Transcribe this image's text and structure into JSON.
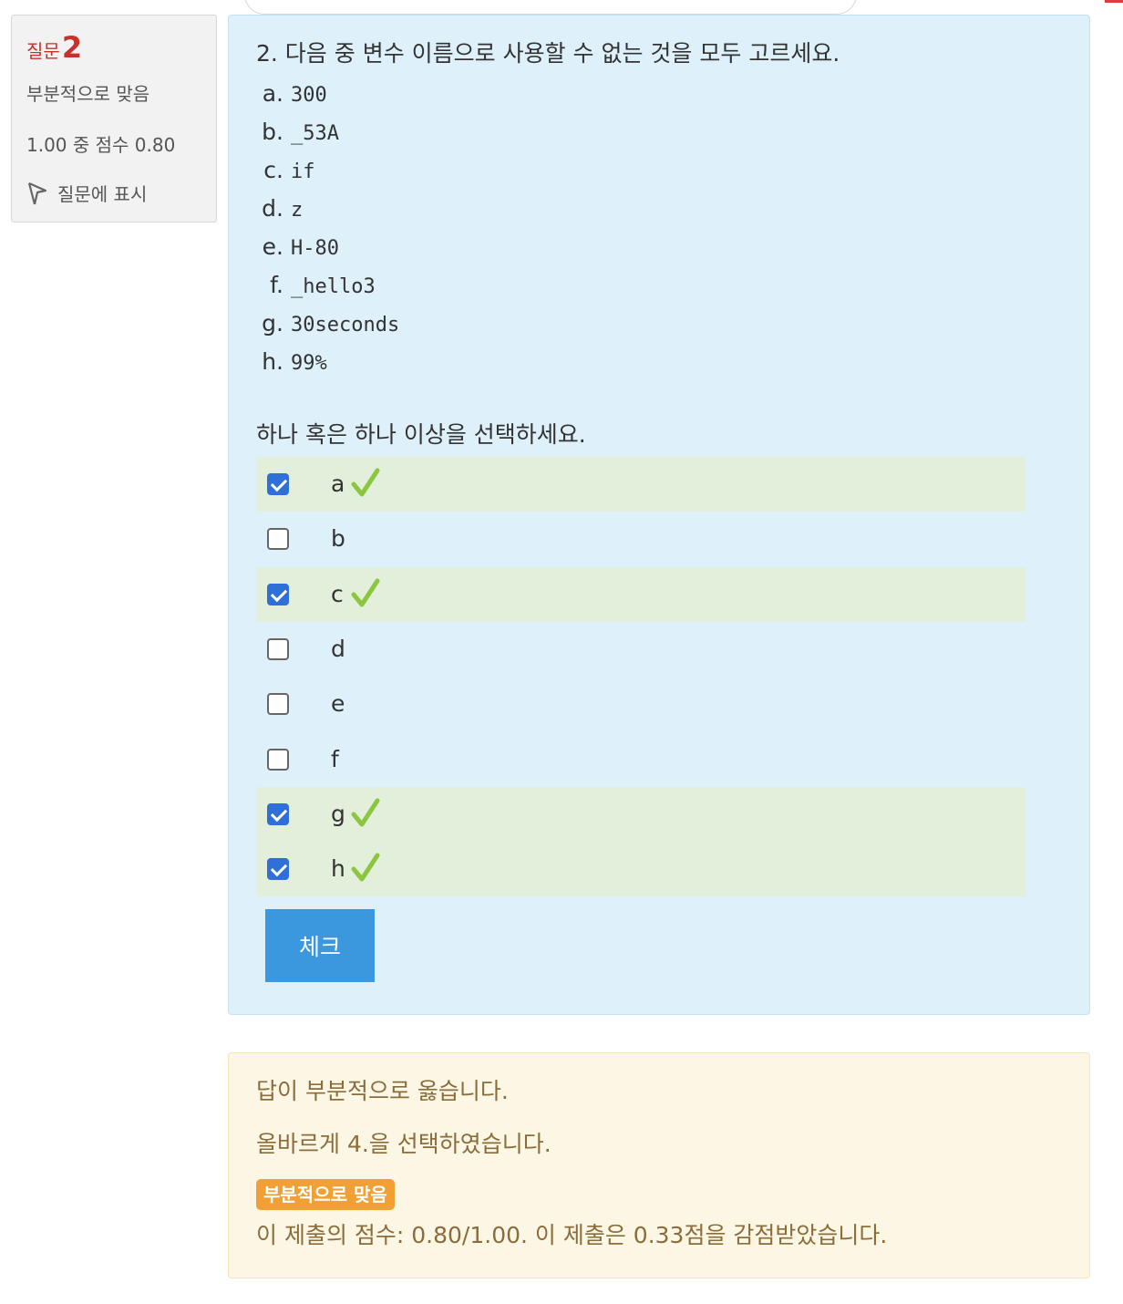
{
  "info": {
    "question_word": "질문",
    "question_number": "2",
    "state": "부분적으로 맞음",
    "grade": "1.00 중 점수 0.80",
    "flag_label": "질문에 표시"
  },
  "question": {
    "text": "2. 다음 중 변수 이름으로 사용할 수 없는 것을 모두 고르세요.",
    "options": [
      {
        "letter": "a.",
        "code": "300"
      },
      {
        "letter": "b.",
        "code": "_53A"
      },
      {
        "letter": "c.",
        "code": "if"
      },
      {
        "letter": "d.",
        "code": "z"
      },
      {
        "letter": "e.",
        "code": "H-80"
      },
      {
        "letter": "f.",
        "code": "_hello3"
      },
      {
        "letter": "g.",
        "code": "30seconds"
      },
      {
        "letter": "h.",
        "code": "99%"
      }
    ],
    "prompt": "하나 혹은 하나 이상을 선택하세요."
  },
  "answers": [
    {
      "label": "a",
      "checked": true,
      "correct": true
    },
    {
      "label": "b",
      "checked": false,
      "correct": false
    },
    {
      "label": "c",
      "checked": true,
      "correct": true
    },
    {
      "label": "d",
      "checked": false,
      "correct": false
    },
    {
      "label": "e",
      "checked": false,
      "correct": false
    },
    {
      "label": "f",
      "checked": false,
      "correct": false
    },
    {
      "label": "g",
      "checked": true,
      "correct": true
    },
    {
      "label": "h",
      "checked": true,
      "correct": true
    }
  ],
  "check_button": "체크",
  "feedback": {
    "line1": "답이 부분적으로 옳습니다.",
    "line2": "올바르게 4.을 선택하였습니다.",
    "badge": "부분적으로 맞음",
    "line3": "이 제출의 점수: 0.80/1.00. 이 제출은 0.33점을 감점받았습니다."
  },
  "colors": {
    "correct_bg": "#e2efdb",
    "tick": "#8cc63f",
    "checkbox": "#2f6fd8",
    "button": "#3b98de",
    "badge": "#f0a035"
  }
}
